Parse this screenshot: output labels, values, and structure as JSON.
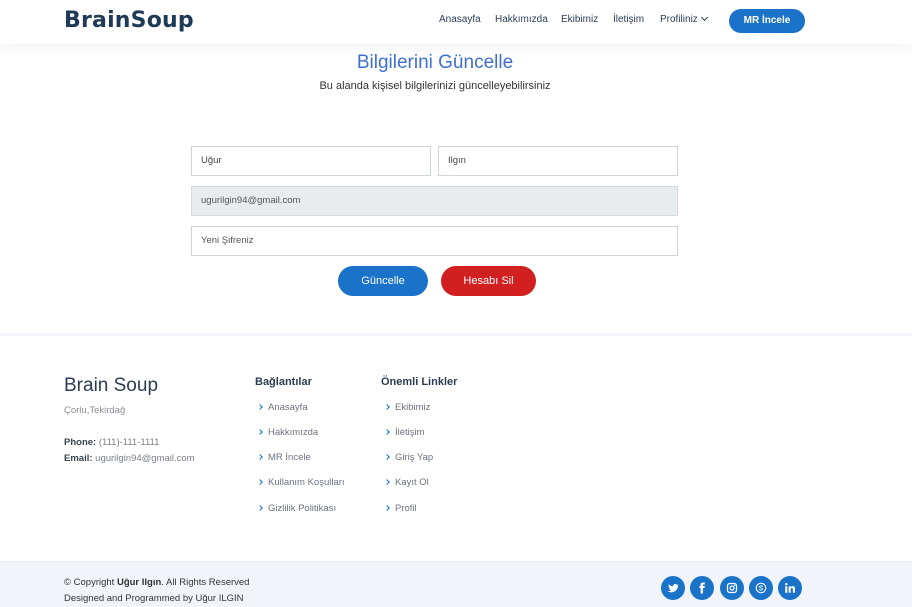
{
  "header": {
    "logo": "BrainSoup",
    "nav": [
      "Anasayfa",
      "Hakkımızda",
      "Ekibimiz",
      "İletişim",
      "Profiliniz"
    ],
    "cta": "MR İncele"
  },
  "main": {
    "title": "Bilgilerini Güncelle",
    "subtitle": "Bu alanda kişisel bilgilerinizi güncelleyebilirsiniz",
    "form": {
      "first_name": "Uğur",
      "last_name": "Ilgın",
      "email": "ugurilgin94@gmail.com",
      "password_placeholder": "Yeni Şifreniz",
      "update_button": "Güncelle",
      "delete_button": "Hesabı Sil"
    }
  },
  "footer": {
    "brand": "Brain Soup",
    "city": "Çorlu,Tekirdağ",
    "phone_label": "Phone:",
    "phone": "(111)-111-1111",
    "email_label": "Email:",
    "email": "ugurilgin94@gmail.com",
    "links_heading": "Bağlantılar",
    "links": [
      "Anasayfa",
      "Hakkımızda",
      "MR İncele",
      "Kullanım Koşulları",
      "Gizlilik Politikası"
    ],
    "important_heading": "Önemli Linkler",
    "important_links": [
      "Ekibimiz",
      "İletişim",
      "Giriş Yap",
      "Kayıt Ol",
      "Profil"
    ],
    "copyright_prefix": "© Copyright",
    "copyright_name": "Uğur Ilgın",
    "copyright_suffix": ". All Rights Reserved",
    "designed": "Designed and Programmed by Uğur ILGIN",
    "social_icons": [
      "twitter-icon",
      "facebook-icon",
      "instagram-icon",
      "skype-icon",
      "linkedin-icon"
    ]
  },
  "colors": {
    "primary": "#1a73c9",
    "danger": "#d21f1f",
    "title_blue": "#3f6fcf",
    "dark_navy": "#1f3a57"
  }
}
